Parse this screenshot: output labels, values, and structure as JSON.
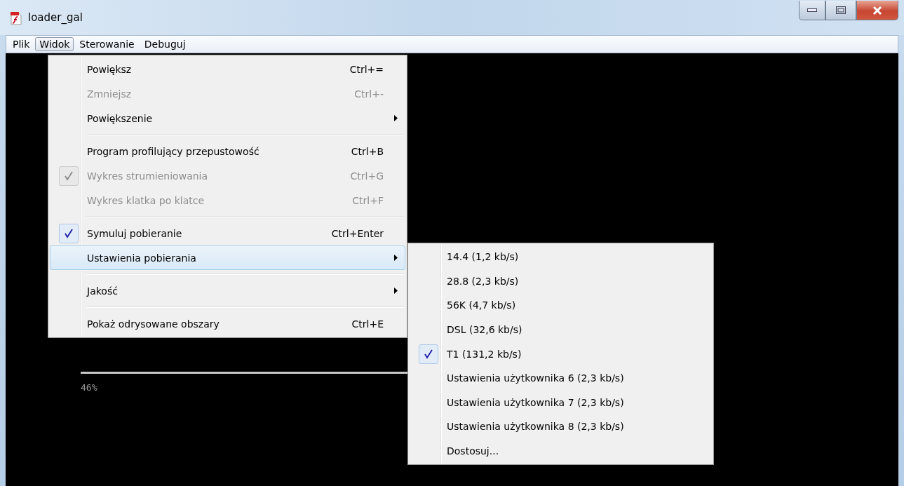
{
  "window": {
    "title": "loader_gal"
  },
  "menubar": [
    {
      "label": "Plik",
      "selected": false
    },
    {
      "label": "Widok",
      "selected": true
    },
    {
      "label": "Sterowanie",
      "selected": false
    },
    {
      "label": "Debuguj",
      "selected": false
    }
  ],
  "menu": [
    {
      "kind": "item",
      "label": "Powiększ",
      "shortcut": "Ctrl+=",
      "disabled": false,
      "checked": false,
      "selected": false,
      "submenu": false
    },
    {
      "kind": "item",
      "label": "Zmniejsz",
      "shortcut": "Ctrl+-",
      "disabled": true,
      "checked": false,
      "selected": false,
      "submenu": false
    },
    {
      "kind": "item",
      "label": "Powiększenie",
      "disabled": false,
      "checked": false,
      "selected": false,
      "submenu": true
    },
    {
      "kind": "separator"
    },
    {
      "kind": "item",
      "label": "Program profilujący przepustowość",
      "shortcut": "Ctrl+B",
      "disabled": false,
      "checked": false,
      "selected": false,
      "submenu": false
    },
    {
      "kind": "item",
      "label": "Wykres strumieniowania",
      "shortcut": "Ctrl+G",
      "disabled": true,
      "checked": true,
      "selected": false,
      "submenu": false
    },
    {
      "kind": "item",
      "label": "Wykres klatka po klatce",
      "shortcut": "Ctrl+F",
      "disabled": true,
      "checked": false,
      "selected": false,
      "submenu": false
    },
    {
      "kind": "separator"
    },
    {
      "kind": "item",
      "label": "Symuluj pobieranie",
      "shortcut": "Ctrl+Enter",
      "disabled": false,
      "checked": true,
      "selected": false,
      "submenu": false
    },
    {
      "kind": "item",
      "label": "Ustawienia pobierania",
      "disabled": false,
      "checked": false,
      "selected": true,
      "submenu": true
    },
    {
      "kind": "separator"
    },
    {
      "kind": "item",
      "label": "Jakość",
      "disabled": false,
      "checked": false,
      "selected": false,
      "submenu": true
    },
    {
      "kind": "separator"
    },
    {
      "kind": "item",
      "label": "Pokaż odrysowane obszary",
      "shortcut": "Ctrl+E",
      "disabled": false,
      "checked": false,
      "selected": false,
      "submenu": false
    }
  ],
  "submenu": [
    {
      "label": "14.4 (1,2 kb/s)",
      "checked": false
    },
    {
      "label": "28.8 (2,3 kb/s)",
      "checked": false
    },
    {
      "label": "56K (4,7 kb/s)",
      "checked": false
    },
    {
      "label": "DSL (32,6 kb/s)",
      "checked": false
    },
    {
      "label": "T1 (131,2 kb/s)",
      "checked": true
    },
    {
      "label": "Ustawienia użytkownika 6 (2,3 kb/s)",
      "checked": false
    },
    {
      "label": "Ustawienia użytkownika 7 (2,3 kb/s)",
      "checked": false
    },
    {
      "label": "Ustawienia użytkownika 8 (2,3 kb/s)",
      "checked": false
    },
    {
      "label": "Dostosuj...",
      "checked": false
    }
  ],
  "progress": {
    "label": "46%"
  }
}
